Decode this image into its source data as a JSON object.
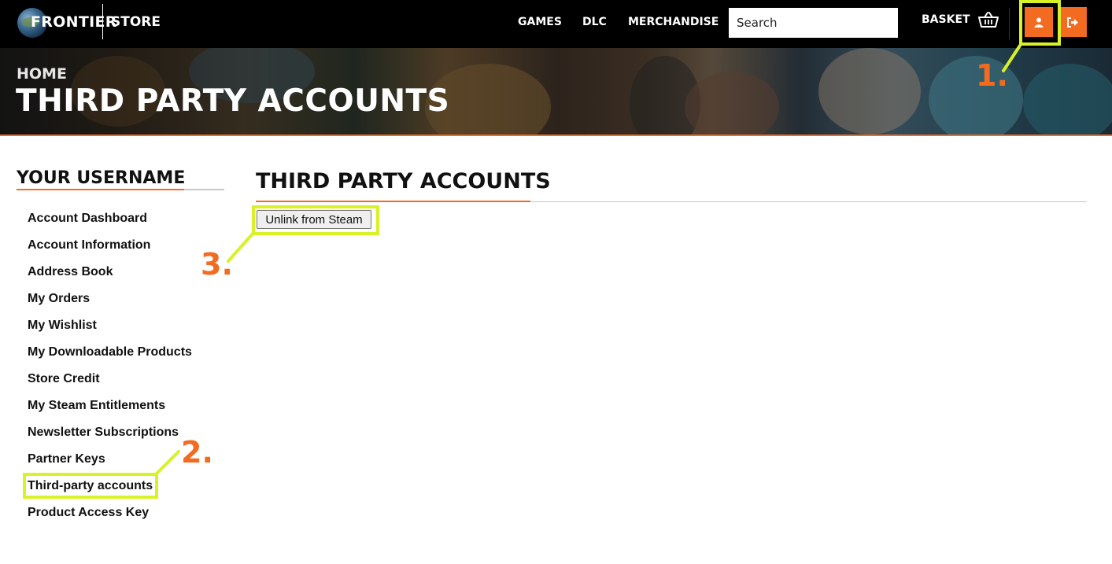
{
  "header": {
    "logo_text": "FRONTIER",
    "store_label": "STORE",
    "nav": [
      "GAMES",
      "DLC",
      "MERCHANDISE"
    ],
    "search_placeholder": "Search",
    "basket_label": "BASKET"
  },
  "hero": {
    "breadcrumb": "HOME",
    "title": "THIRD PARTY ACCOUNTS"
  },
  "sidebar": {
    "title": "YOUR USERNAME",
    "items": [
      "Account Dashboard",
      "Account Information",
      "Address Book",
      "My Orders",
      "My Wishlist",
      "My Downloadable Products",
      "Store Credit",
      "My Steam Entitlements",
      "Newsletter Subscriptions",
      "Partner Keys",
      "Third-party accounts",
      "Product Access Key"
    ]
  },
  "main": {
    "title": "THIRD PARTY ACCOUNTS",
    "unlink_button": "Unlink from Steam"
  },
  "annotations": {
    "step1": "1.",
    "step2": "2.",
    "step3": "3."
  },
  "colors": {
    "accent": "#f26b21",
    "highlight": "#d8f227",
    "topbar": "#000000"
  },
  "icons": [
    "globe-logo-icon",
    "basket-icon",
    "user-icon",
    "logout-icon"
  ]
}
